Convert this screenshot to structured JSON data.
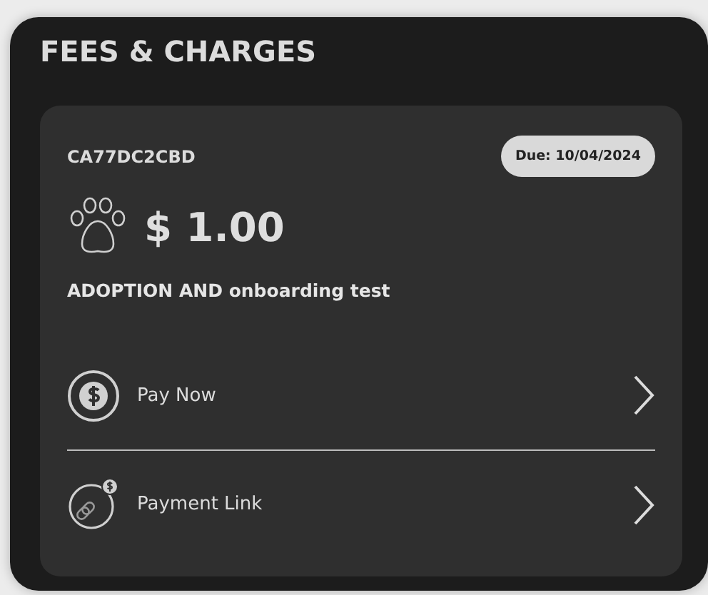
{
  "panel": {
    "title": "FEES & CHARGES"
  },
  "fee": {
    "reference": "CA77DC2CBD",
    "due_badge": "Due: 10/04/2024",
    "amount": "$ 1.00",
    "description": "ADOPTION AND onboarding test",
    "actions": [
      {
        "kind": "pay",
        "label": "Pay Now"
      },
      {
        "kind": "link",
        "label": "Payment Link"
      }
    ]
  }
}
